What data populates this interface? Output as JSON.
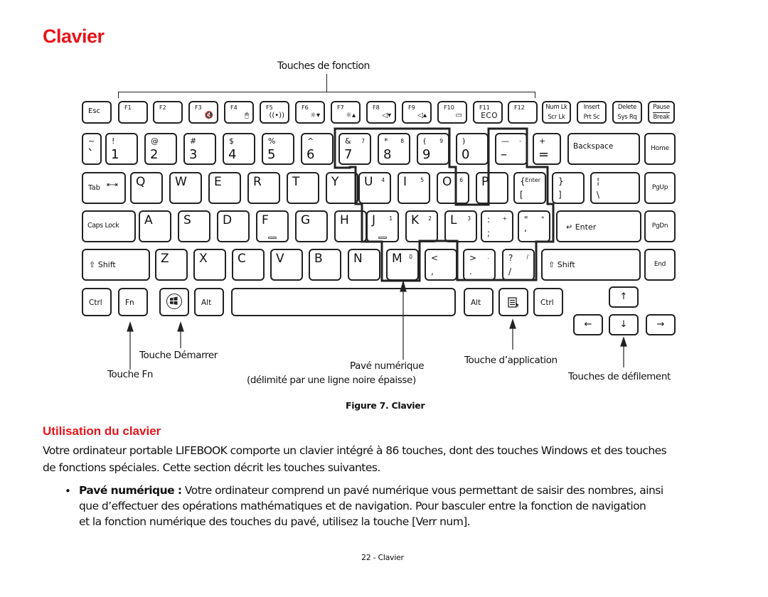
{
  "page": {
    "title": "Clavier",
    "figure_caption": "Figure 7.  Clavier",
    "section_heading": "Utilisation du clavier",
    "intro_lines": [
      "Votre ordinateur portable LIFEBOOK comporte un clavier intégré à 86 touches, dont des touches Windows et des touches",
      "de fonctions spéciales. Cette section décrit les touches suivantes."
    ],
    "bullet": {
      "term": "Pavé numérique :",
      "lines": [
        " Votre ordinateur comprend un pavé numérique vous permettant de saisir des nombres, ainsi",
        "que d’effectuer des opérations mathématiques et de navigation. Pour basculer entre la fonction de navigation",
        "et la fonction numérique des touches du pavé, utilisez la touche [Verr num]."
      ]
    },
    "footer": "22 - Clavier"
  },
  "callouts": {
    "function_keys": "Touches de fonction",
    "start_key": "Touche Démarrer",
    "fn_key": "Touche Fn",
    "numpad": "Pavé numérique",
    "numpad_note": "(délimité par une ligne noire épaisse)",
    "app_key": "Touche d’application",
    "scroll_keys": "Touches de défilement"
  },
  "keyboard": {
    "total_keys": 86,
    "row_function": [
      {
        "id": "esc",
        "main": "Esc"
      },
      {
        "id": "f1",
        "main": "F1"
      },
      {
        "id": "f2",
        "main": "F2"
      },
      {
        "id": "f3",
        "main": "F3",
        "icon": "mute-icon",
        "glyph": "🔇"
      },
      {
        "id": "f4",
        "main": "F4",
        "icon": "touchpad-mouse-icon",
        "glyph": "🖱"
      },
      {
        "id": "f5",
        "main": "F5",
        "icon": "wireless-icon",
        "glyph": "((•))"
      },
      {
        "id": "f6",
        "main": "F6",
        "icon": "brightness-down-icon",
        "glyph": "☼▾"
      },
      {
        "id": "f7",
        "main": "F7",
        "icon": "brightness-up-icon",
        "glyph": "☼▴"
      },
      {
        "id": "f8",
        "main": "F8",
        "icon": "volume-down-icon",
        "glyph": "◁▾"
      },
      {
        "id": "f9",
        "main": "F9",
        "icon": "volume-up-icon",
        "glyph": "◁▴"
      },
      {
        "id": "f10",
        "main": "F10",
        "icon": "display-icon",
        "glyph": "▭"
      },
      {
        "id": "f11",
        "main": "F11",
        "sub": "ECO"
      },
      {
        "id": "f12",
        "main": "F12"
      },
      {
        "id": "numlk",
        "main": "Num Lk",
        "sub": "Scr Lk"
      },
      {
        "id": "insert",
        "main": "Insert",
        "sub": "Prt Sc"
      },
      {
        "id": "delete",
        "main": "Delete",
        "sub": "Sys Rq"
      },
      {
        "id": "pause",
        "main": "Pause",
        "sub": "Break"
      }
    ],
    "row_number": [
      {
        "id": "tilde",
        "top": "~",
        "bottom": "`"
      },
      {
        "id": "1",
        "top": "!",
        "bottom": "1"
      },
      {
        "id": "2",
        "top": "@",
        "bottom": "2"
      },
      {
        "id": "3",
        "top": "#",
        "bottom": "3"
      },
      {
        "id": "4",
        "top": "$",
        "bottom": "4"
      },
      {
        "id": "5",
        "top": "%",
        "bottom": "5"
      },
      {
        "id": "6",
        "top": "^",
        "bottom": "6"
      },
      {
        "id": "7",
        "top": "&",
        "bottom": "7",
        "pad": "7"
      },
      {
        "id": "8",
        "top": "*",
        "bottom": "8",
        "pad": "8"
      },
      {
        "id": "9",
        "top": "(",
        "bottom": "9",
        "pad": "9"
      },
      {
        "id": "0",
        "top": ")",
        "bottom": "0"
      },
      {
        "id": "minus",
        "top": "—",
        "bottom": "–",
        "pad": "-"
      },
      {
        "id": "equal",
        "top": "+",
        "bottom": "="
      },
      {
        "id": "backspace",
        "main": "Backspace"
      },
      {
        "id": "home",
        "main": "Home"
      }
    ],
    "row_qwerty": [
      {
        "id": "tab",
        "main": "Tab",
        "glyph": "⇤⇥"
      },
      {
        "id": "q",
        "top": "Q"
      },
      {
        "id": "w",
        "top": "W"
      },
      {
        "id": "e",
        "top": "E"
      },
      {
        "id": "r",
        "top": "R"
      },
      {
        "id": "t",
        "top": "T"
      },
      {
        "id": "y",
        "top": "Y"
      },
      {
        "id": "u",
        "top": "U",
        "pad": "4"
      },
      {
        "id": "i",
        "top": "I",
        "pad": "5"
      },
      {
        "id": "o",
        "top": "O",
        "pad": "6"
      },
      {
        "id": "p",
        "top": "P"
      },
      {
        "id": "lbracket",
        "top": "{",
        "bottom": "[",
        "pad": "Enter"
      },
      {
        "id": "rbracket",
        "top": "}",
        "bottom": "]"
      },
      {
        "id": "backslash",
        "top": "¦",
        "bottom": "\\"
      },
      {
        "id": "pgup",
        "main": "PgUp"
      }
    ],
    "row_home": [
      {
        "id": "capslock",
        "main": "Caps Lock"
      },
      {
        "id": "a",
        "top": "A"
      },
      {
        "id": "s",
        "top": "S"
      },
      {
        "id": "d",
        "top": "D"
      },
      {
        "id": "f",
        "top": "F",
        "bump": true
      },
      {
        "id": "g",
        "top": "G"
      },
      {
        "id": "h",
        "top": "H"
      },
      {
        "id": "j",
        "top": "J",
        "pad": "1",
        "bump": true
      },
      {
        "id": "k",
        "top": "K",
        "pad": "2"
      },
      {
        "id": "l",
        "top": "L",
        "pad": "3"
      },
      {
        "id": "semicolon",
        "top": ":",
        "bottom": ";",
        "pad": "+"
      },
      {
        "id": "quote",
        "top": "\"",
        "bottom": "‘",
        "pad": "*"
      },
      {
        "id": "enter",
        "main": "↵ Enter"
      },
      {
        "id": "pgdn",
        "main": "PgDn"
      }
    ],
    "row_shift": [
      {
        "id": "lshift",
        "main": "⇧ Shift"
      },
      {
        "id": "z",
        "top": "Z"
      },
      {
        "id": "x",
        "top": "X"
      },
      {
        "id": "c",
        "top": "C"
      },
      {
        "id": "v",
        "top": "V"
      },
      {
        "id": "b",
        "top": "B"
      },
      {
        "id": "n",
        "top": "N"
      },
      {
        "id": "m",
        "top": "M",
        "pad": "0"
      },
      {
        "id": "comma",
        "top": "<",
        "bottom": ","
      },
      {
        "id": "period",
        "top": ">",
        "bottom": ".",
        "pad": "."
      },
      {
        "id": "slash",
        "top": "?",
        "bottom": "/",
        "pad": "/"
      },
      {
        "id": "rshift",
        "main": "⇧ Shift"
      },
      {
        "id": "end",
        "main": "End"
      }
    ],
    "row_bottom": [
      {
        "id": "lctrl",
        "main": "Ctrl"
      },
      {
        "id": "fn",
        "main": "Fn"
      },
      {
        "id": "win",
        "main": "",
        "icon": "windows-logo-icon"
      },
      {
        "id": "lalt",
        "main": "Alt"
      },
      {
        "id": "space",
        "main": ""
      },
      {
        "id": "ralt",
        "main": "Alt"
      },
      {
        "id": "app",
        "main": "",
        "icon": "application-menu-icon"
      },
      {
        "id": "rctrl",
        "main": "Ctrl"
      }
    ],
    "arrows": [
      {
        "id": "up",
        "main": "↑"
      },
      {
        "id": "left",
        "main": "←"
      },
      {
        "id": "down",
        "main": "↓"
      },
      {
        "id": "right",
        "main": "→"
      }
    ]
  }
}
